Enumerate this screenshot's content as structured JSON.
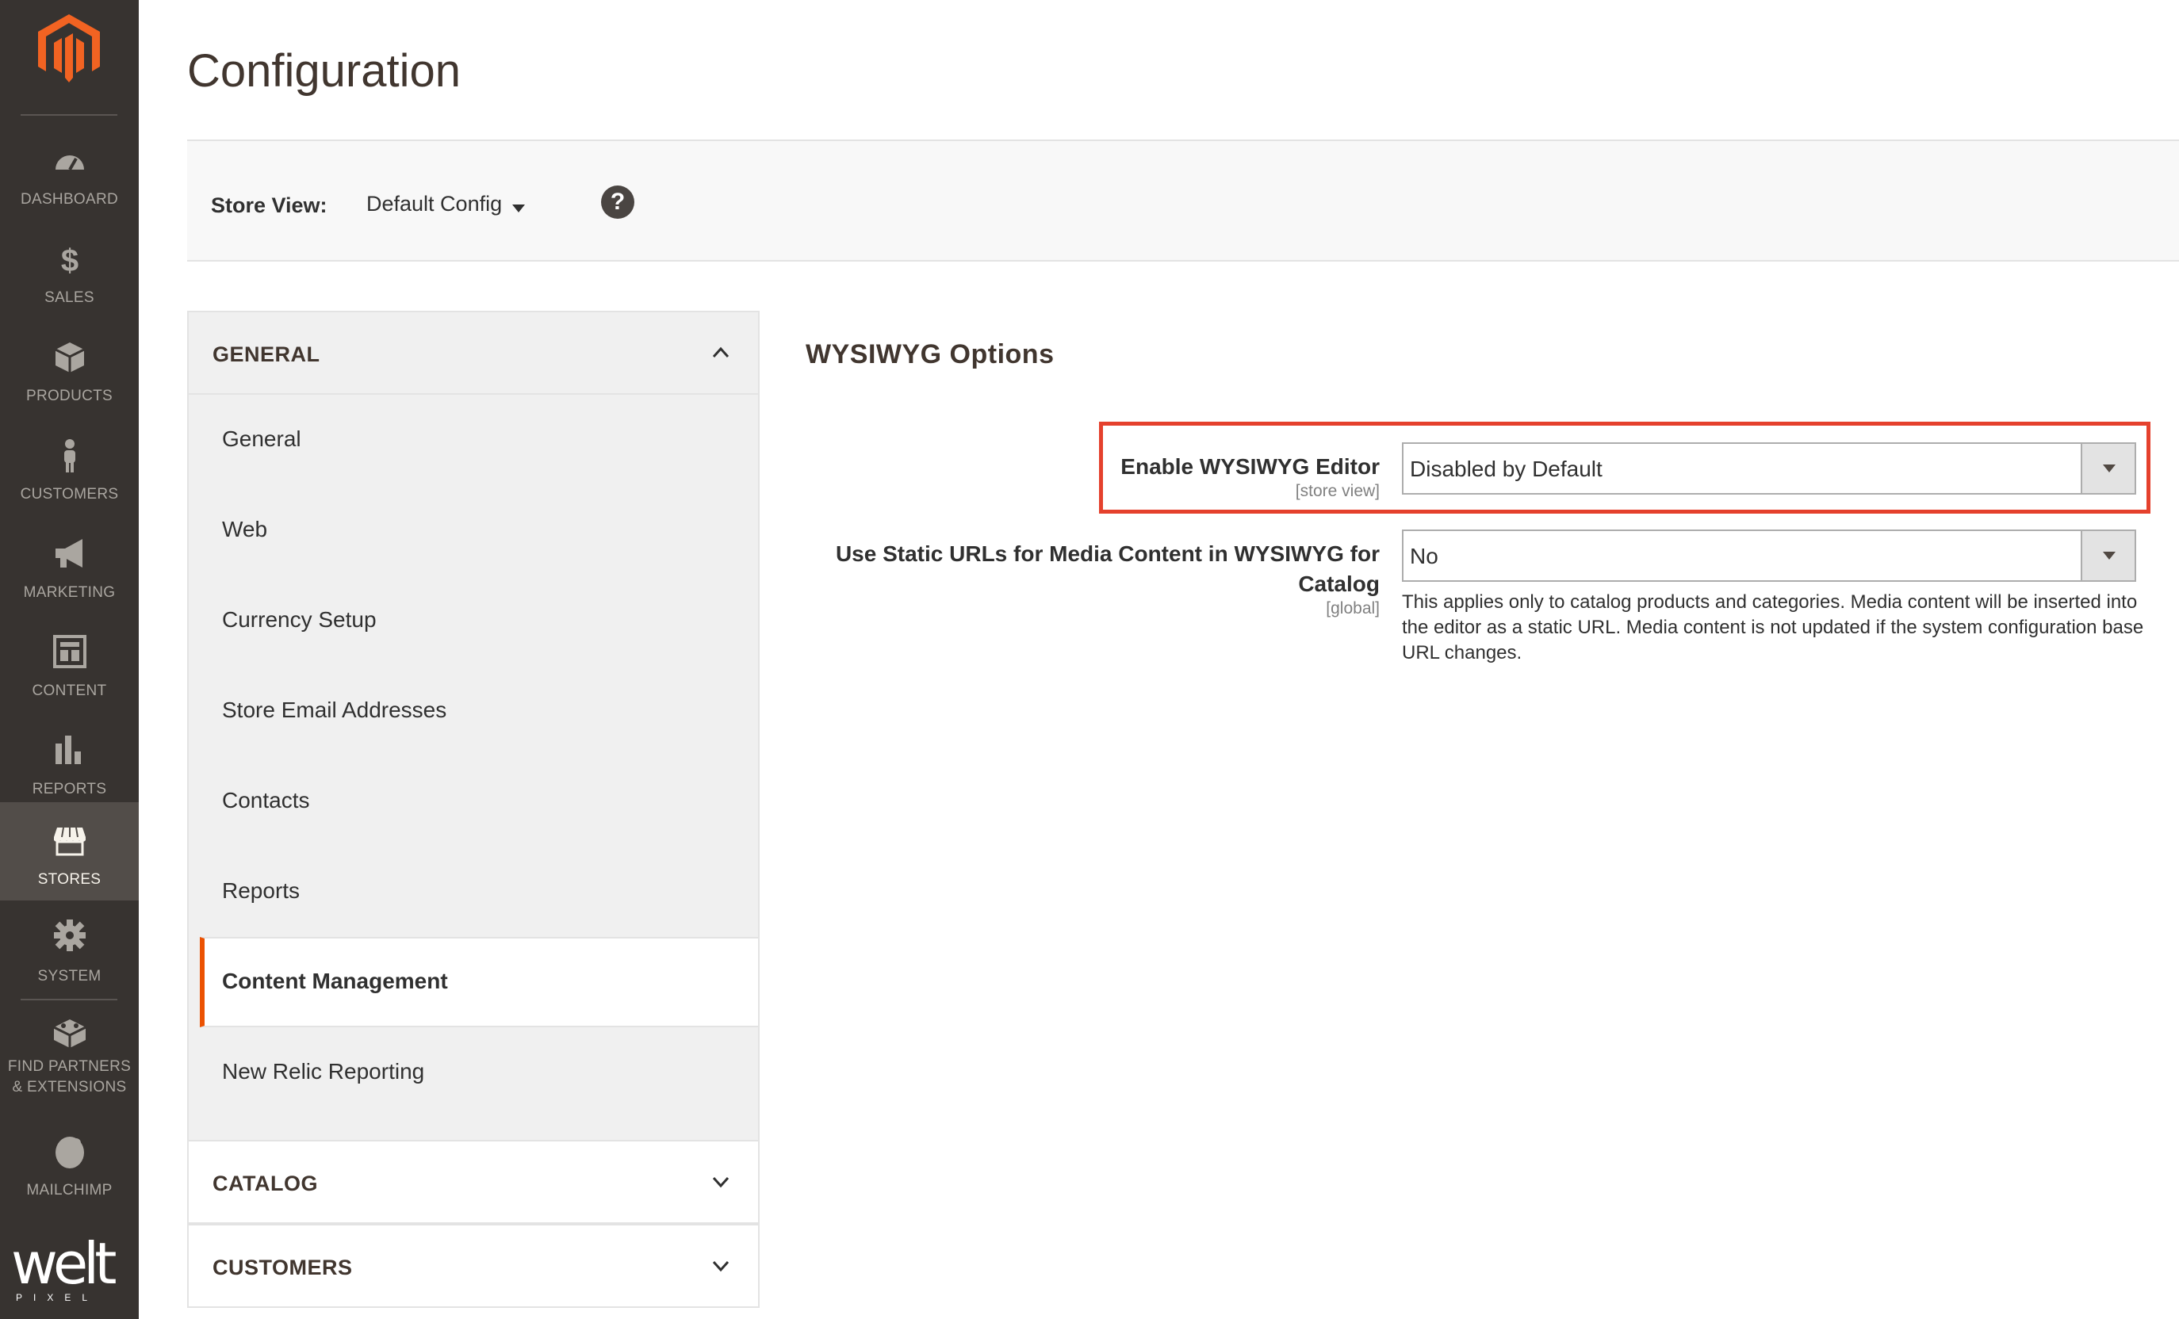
{
  "sidebar": {
    "items": [
      {
        "label": "DASHBOARD",
        "icon": "dashboard-gauge-icon"
      },
      {
        "label": "SALES",
        "icon": "dollar-icon"
      },
      {
        "label": "PRODUCTS",
        "icon": "box-icon"
      },
      {
        "label": "CUSTOMERS",
        "icon": "person-icon"
      },
      {
        "label": "MARKETING",
        "icon": "megaphone-icon"
      },
      {
        "label": "CONTENT",
        "icon": "layout-icon"
      },
      {
        "label": "REPORTS",
        "icon": "bar-chart-icon"
      },
      {
        "label": "STORES",
        "icon": "storefront-icon",
        "active": true
      },
      {
        "label": "SYSTEM",
        "icon": "gear-icon"
      },
      {
        "label": "FIND PARTNERS",
        "label2": "& EXTENSIONS",
        "icon": "blocks-icon"
      },
      {
        "label": "MAILCHIMP",
        "icon": "mailchimp-icon"
      }
    ],
    "brand_word": "welt",
    "brand_sub": "PIXEL"
  },
  "page": {
    "title": "Configuration"
  },
  "scope": {
    "label": "Store View:",
    "value": "Default Config",
    "help": "?"
  },
  "tabs": {
    "general": {
      "title": "GENERAL",
      "items": [
        "General",
        "Web",
        "Currency Setup",
        "Store Email Addresses",
        "Contacts",
        "Reports",
        "Content Management",
        "New Relic Reporting"
      ],
      "active_item": "Content Management"
    },
    "catalog": {
      "title": "CATALOG"
    },
    "customers": {
      "title": "CUSTOMERS"
    }
  },
  "section": {
    "title": "WYSIWYG Options",
    "fields": [
      {
        "label": "Enable WYSIWYG Editor",
        "scope": "[store view]",
        "value": "Disabled by Default"
      },
      {
        "label_line1": "Use Static URLs for Media Content in WYSIWYG for",
        "label_line2": "Catalog",
        "scope": "[global]",
        "value": "No",
        "comment": "This applies only to catalog products and categories. Media content will be inserted into the editor as a static URL. Media content is not updated if the system configuration base URL changes."
      }
    ]
  },
  "colors": {
    "sidebar_bg": "#373330",
    "sidebar_active_bg": "#524d49",
    "accent": "#eb5202",
    "highlight_border": "#e5412d"
  }
}
